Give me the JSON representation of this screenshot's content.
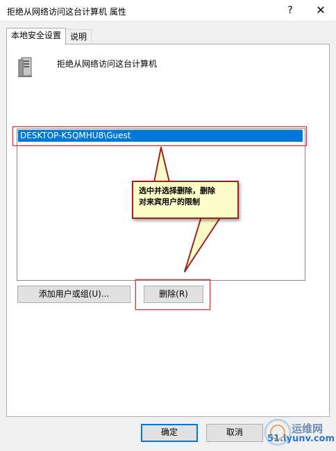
{
  "window": {
    "title": "拒绝从网络访问这台计算机 属性",
    "help_label": "?",
    "close_label": "✕"
  },
  "tabs": [
    {
      "label": "本地安全设置"
    },
    {
      "label": "说明"
    }
  ],
  "policy": {
    "title": "拒绝从网络访问这台计算机",
    "icon": "server-icon"
  },
  "list": {
    "items": [
      {
        "label": "DESKTOP-K5QMHU8\\Guest",
        "selected": true
      }
    ]
  },
  "buttons": {
    "add_label": "添加用户或组(U)...",
    "remove_label": "删除(R)",
    "ok_label": "确定",
    "cancel_label": "取消"
  },
  "annotation": {
    "line1": "选中并选择删除，删除",
    "line2": "对来宾用户的限制",
    "highlight_color": "#e0262c"
  },
  "watermark": {
    "text1": "运维网",
    "text2": "51.iyunv.com"
  },
  "colors": {
    "selection": "#0078d7",
    "callout_fill": "#fdfdc8",
    "callout_border": "#a51c1c"
  }
}
